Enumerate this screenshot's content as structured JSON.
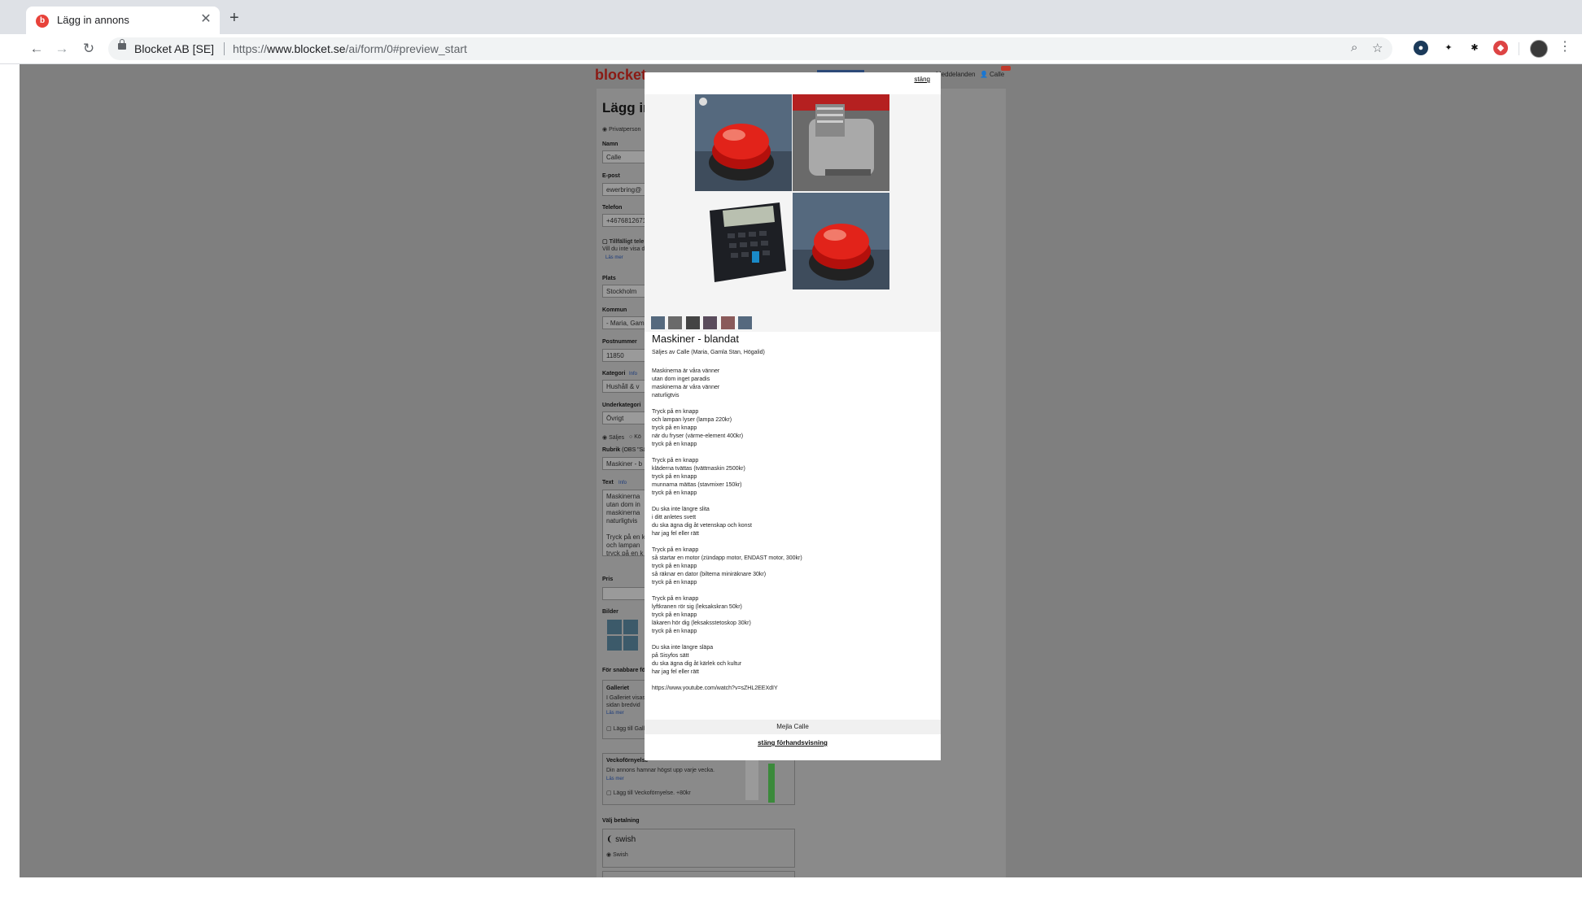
{
  "browser": {
    "tab_title": "Lägg in annons",
    "favicon_letter": "b",
    "site_identity": "Blocket AB [SE]",
    "url_prefix": "https://",
    "url_host": "www.blocket.se",
    "url_path": "/ai/form/0#preview_start"
  },
  "background_form": {
    "logo": "blocket",
    "nav_messages": "Meddelanden",
    "nav_user": "Calle",
    "heading": "Lägg in",
    "seller_type": "Privatperson",
    "name_label": "Namn",
    "name_value": "Calle",
    "email_label": "E-post",
    "email_value": "ewerbring@",
    "phone_label": "Telefon",
    "phone_value": "+4676812671",
    "temp_phone_label": "Tillfälligt tele",
    "temp_phone_text": "Vill du inte visa d",
    "read_more": "Läs mer",
    "place_label": "Plats",
    "place_value": "Stockholm",
    "municipality_label": "Kommun",
    "municipality_value": "- Maria, Gam",
    "zip_label": "Postnummer",
    "zip_value": "11850",
    "category_label": "Kategori",
    "category_info": "Info",
    "category_value": "Hushåll & v",
    "subcategory_label": "Underkategori",
    "subcategory_value": "Övrigt",
    "sell_option": "Säljes",
    "buy_option": "Kö",
    "heading_label": "Rubrik",
    "heading_hint": "(OBS \"Sä",
    "heading_value": "Maskiner - b",
    "text_label": "Text",
    "text_info": "Info",
    "text_value": "Maskinerna\nutan dom in\nmaskinerna\nnaturligtvis\n\nTryck på en k\noch lampan\ntryck på en k\nnär du fryse",
    "price_label": "Pris",
    "images_label": "Bilder",
    "quick_sale_label": "För snabbare fö",
    "gallery_title": "Galleriet",
    "gallery_text1": "I Galleriet visas",
    "gallery_text2": "sidan bredvid",
    "gallery_read_more": "Läs mer",
    "gallery_add": "Lägg till Gall",
    "weekly_title": "Veckoförnyelse",
    "weekly_text": "Din annons hamnar högst upp varje vecka.",
    "weekly_read_more": "Läs mer",
    "weekly_add": "Lägg till Veckoförnyelse. +80kr",
    "payment_label": "Välj betalning",
    "swish_logo": "swish",
    "swish_option": "Swish"
  },
  "modal": {
    "close_top": "stäng",
    "title": "Maskiner - blandat",
    "seller_line": "Säljes av Calle (Maria, Gamla Stan, Högalid)",
    "paragraphs": [
      "Maskinerna är våra vänner\nutan dom inget paradis\nmaskinerna är våra vänner\nnaturligtvis",
      "Tryck på en knapp\noch lampan lyser (lampa 220kr)\ntryck på en knapp\nnär du fryser (värme-element 400kr)\ntryck på en knapp",
      "Tryck på en knapp\nkläderna tvättas (tvättmaskin 2500kr)\ntryck på en knapp\nmunnarna mättas (stavmixer 150kr)\ntryck på en knapp",
      "Du ska inte längre slita\ni ditt anletes svett\ndu ska ägna dig åt vetenskap och konst\nhar jag fel eller rätt",
      "Tryck på en knapp\nså startar en motor (zündapp motor, ENDAST motor, 300kr)\ntryck på en knapp\nså räknar en dator (biltema miniräknare 30kr)\ntryck på en knapp",
      "Tryck på en knapp\nlyftkranen rör sig (leksakskran 50kr)\ntryck på en knapp\nläkaren hör dig (leksaksstetoskop 30kr)\ntryck på en knapp",
      "Du ska inte längre släpa\npå Sisyfos sätt\ndu ska ägna dig åt kärlek och kultur\nhar jag fel eller rätt"
    ],
    "link": "https://www.youtube.com/watch?v=sZHL2EEXdIY",
    "mail_button": "Mejla Calle",
    "close_preview": "stäng förhandsvisning"
  },
  "colors": {
    "brand_red": "#8b1a14",
    "overlay": "#7f7f7f"
  }
}
